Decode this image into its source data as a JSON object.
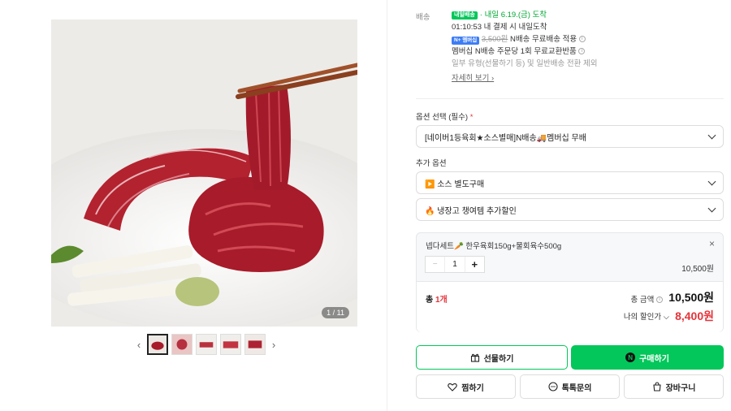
{
  "gallery": {
    "counter": "1 / 11",
    "prev_arrow": "‹",
    "next_arrow": "›",
    "thumbnail_count": 5
  },
  "shipping": {
    "label": "배송",
    "badge": "내일배송",
    "arrival": "· 내일 6.19.(금) 도착",
    "deadline": "01:10:53  내 결제 시 내일도착",
    "membership_badge": "N+ 멤버십",
    "original_fee": "3,500원",
    "free_text": " N배송 무료배송 적용",
    "exchange_text": "멤버십 N배송 주문당 1회 무료교환반품",
    "note": "일부 유형(선물하기 등) 및 일반배송 전환 제외",
    "detail_link": "자세히 보기 ›"
  },
  "options": {
    "label": "옵션 선택 (필수)",
    "required_mark": "*",
    "selected": "[네이버1등육회★소스별매]N배송🚚멤버십 무배"
  },
  "extra_options": {
    "label": "추가 옵션",
    "items": [
      {
        "label": "▶️ 소스 별도구매"
      },
      {
        "label": "🔥 냉장고 챙여템 추가할인"
      }
    ]
  },
  "cart": {
    "item_name": "넵다세트🥕 한우육회150g+물회육수500g",
    "close": "×",
    "minus": "−",
    "quantity": "1",
    "plus": "+",
    "price": "10,500원",
    "total_prefix": "총 ",
    "total_count": "1개",
    "total_label": "총 금액",
    "total_value": "10,500원",
    "discount_label": "나의 할인가 ⌵",
    "discount_value": "8,400원"
  },
  "actions": {
    "gift": "선물하기",
    "buy": "구매하기",
    "wish": "찜하기",
    "talk": "톡톡문의",
    "cart": "장바구니"
  },
  "colors": {
    "naver_green": "#03c75a",
    "price_red": "#e4343b"
  }
}
